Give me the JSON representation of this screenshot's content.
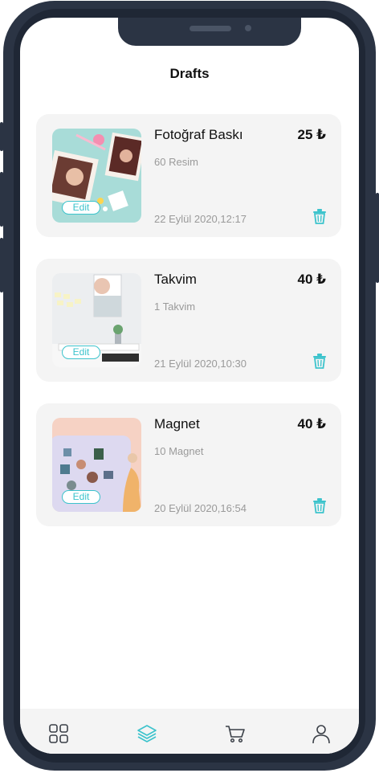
{
  "header": {
    "title": "Drafts"
  },
  "edit_label": "Edit",
  "drafts": [
    {
      "title": "Fotoğraf Baskı",
      "price": "25 ₺",
      "count": "60 Resim",
      "date": "22 Eylül 2020,12:17"
    },
    {
      "title": "Takvim",
      "price": "40 ₺",
      "count": "1 Takvim",
      "date": "21 Eylül 2020,10:30"
    },
    {
      "title": "Magnet",
      "price": "40 ₺",
      "count": "10 Magnet",
      "date": "20 Eylül 2020,16:54"
    }
  ],
  "colors": {
    "accent": "#3cc3cc",
    "frame": "#2b3444",
    "card": "#f4f4f4"
  },
  "tab_bar": {
    "items": [
      {
        "icon": "grid-icon",
        "active": false
      },
      {
        "icon": "layers-icon",
        "active": true
      },
      {
        "icon": "cart-icon",
        "active": false
      },
      {
        "icon": "profile-icon",
        "active": false
      }
    ]
  }
}
